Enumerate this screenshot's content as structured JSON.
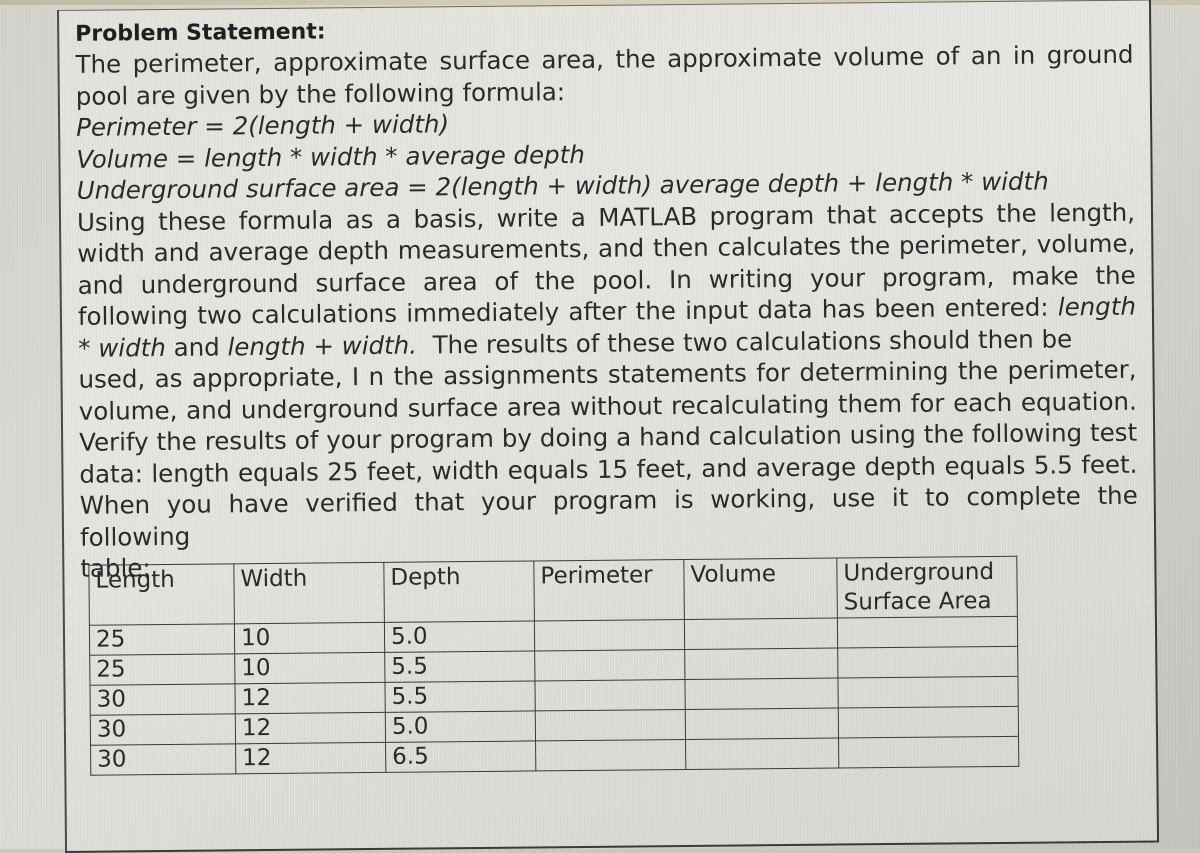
{
  "document": {
    "title": "Problem Statement:",
    "lines": [
      "The perimeter, approximate surface area, the approximate volume of an in ground",
      "pool are given by the following formula:"
    ],
    "formulas": [
      "Perimeter = 2(length + width)",
      "Volume = length * width * average depth",
      "Underground surface area = 2(length + width) average depth + length * width"
    ],
    "paragraph": [
      "Using these formula as a basis, write a MATLAB program that accepts the length,",
      "width and average depth measurements, and then calculates the perimeter, volume,",
      "and underground surface area of the pool.  In writing your program, make the",
      "following two calculations immediately after the input data has been entered:",
      "length",
      "* width",
      "and",
      "length + width.",
      "The results of these two calculations should then be",
      "used, as appropriate, I n the assignments statements for determining the perimeter,",
      "volume, and underground surface area without recalculating them for each equation.",
      "Verify the results of your program by doing a hand calculation using the following test",
      "data: length equals 25 feet, width equals 15 feet, and average depth equals 5.5 feet.",
      "When you have verified that your program is working, use it to complete the following",
      "table:"
    ]
  },
  "table": {
    "headers": [
      "Length",
      "Width",
      "Depth",
      "Perimeter",
      "Volume",
      "Underground Surface Area"
    ],
    "rows": [
      [
        "25",
        "10",
        "5.0",
        "",
        "",
        ""
      ],
      [
        "25",
        "10",
        "5.5",
        "",
        "",
        ""
      ],
      [
        "30",
        "12",
        "5.5",
        "",
        "",
        ""
      ],
      [
        "30",
        "12",
        "5.0",
        "",
        "",
        ""
      ],
      [
        "30",
        "12",
        "6.5",
        "",
        "",
        ""
      ]
    ]
  }
}
